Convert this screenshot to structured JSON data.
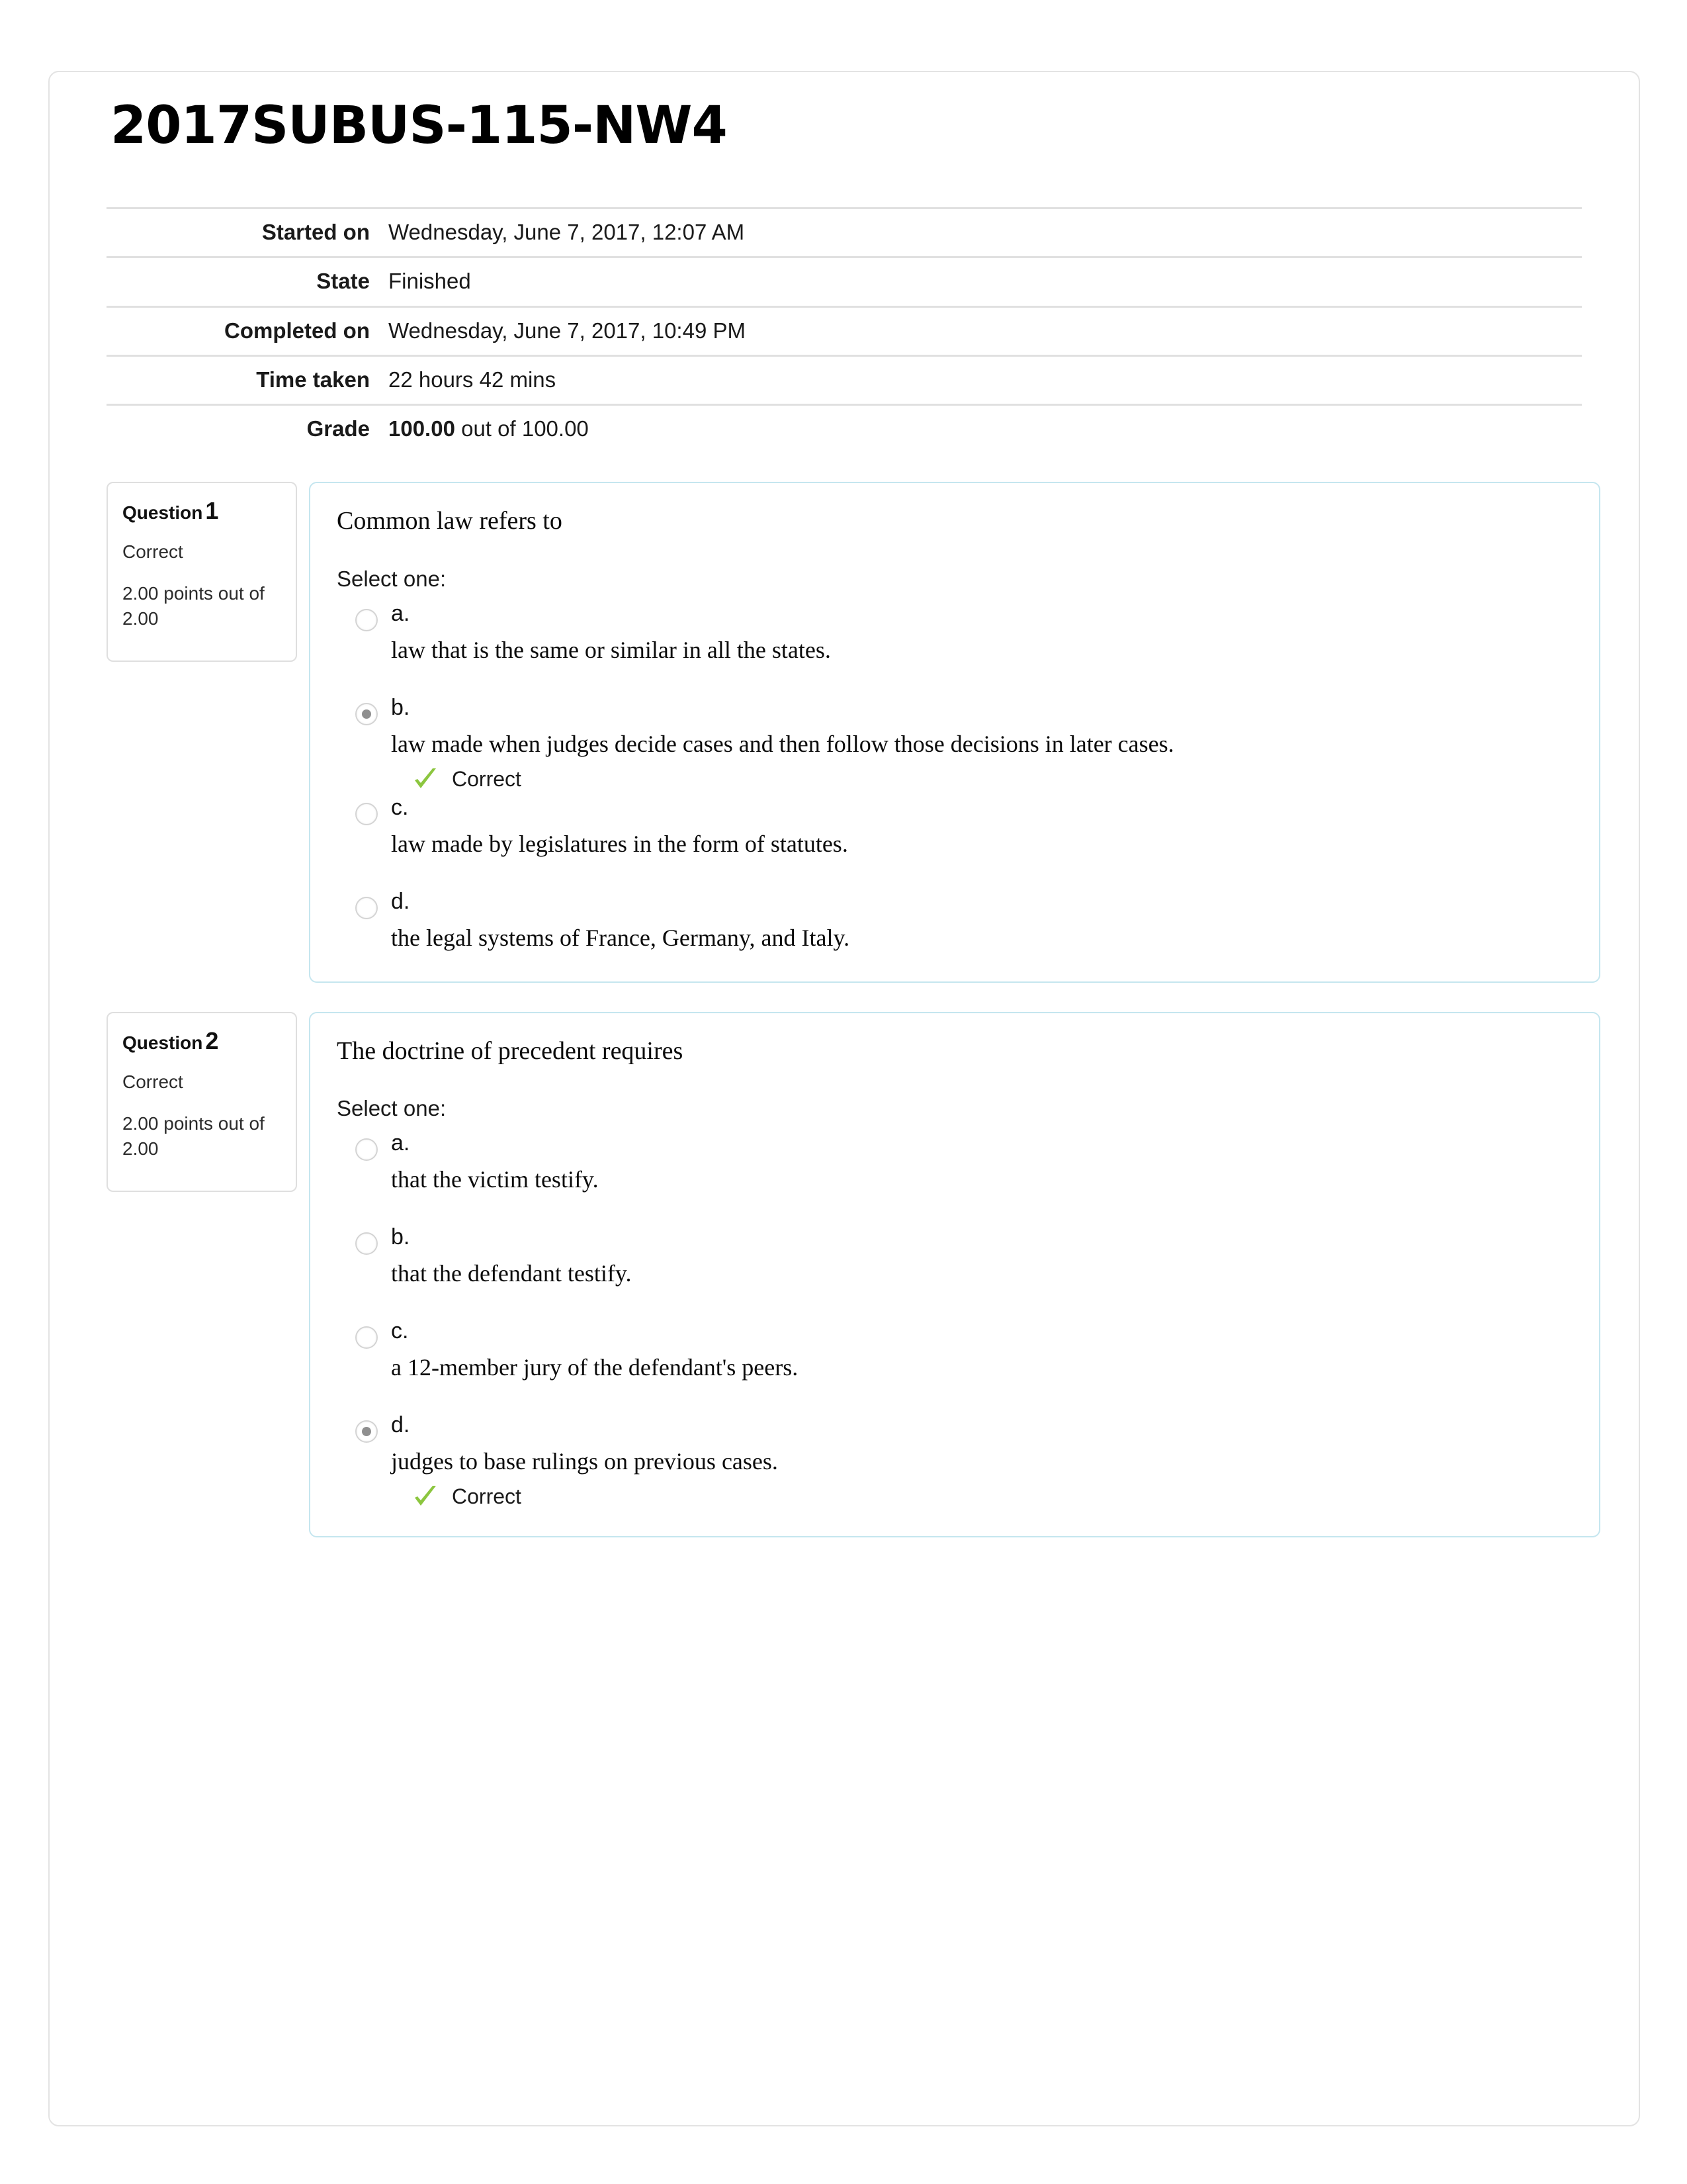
{
  "quiz": {
    "title": "2017SUBUS-115-NW4"
  },
  "summary": {
    "rows": [
      {
        "label": "Started on",
        "value": "Wednesday, June 7, 2017, 12:07 AM"
      },
      {
        "label": "State",
        "value": "Finished"
      },
      {
        "label": "Completed on",
        "value": "Wednesday, June 7, 2017, 10:49 PM"
      },
      {
        "label": "Time taken",
        "value": "22 hours 42 mins"
      }
    ],
    "grade": {
      "label": "Grade",
      "score": "100.00",
      "suffix": " out of 100.00"
    }
  },
  "colors": {
    "card_border": "#c5e6ef",
    "info_border": "#dfdfdf",
    "container_border": "#e3e3e3",
    "correct_green": "#8cc63f",
    "rule": "#e0e0e0"
  },
  "icons": {
    "correct": "check-icon"
  },
  "questions": [
    {
      "info": {
        "heading": "Question",
        "number": "1",
        "state": "Correct",
        "grade": "2.00 points out of 2.00"
      },
      "text": "Common law refers to",
      "select_prompt": "Select one:",
      "options": [
        {
          "letter": "a.",
          "text": "law that is the same or similar in all the states.",
          "selected": false,
          "feedback": ""
        },
        {
          "letter": "b.",
          "text": "law made when judges decide cases and then follow those decisions in later cases.",
          "selected": true,
          "feedback": "Correct"
        },
        {
          "letter": "c.",
          "text": "law made by legislatures in the form of statutes.",
          "selected": false,
          "feedback": ""
        },
        {
          "letter": "d.",
          "text": "the legal systems of France, Germany, and Italy.",
          "selected": false,
          "feedback": ""
        }
      ]
    },
    {
      "info": {
        "heading": "Question",
        "number": "2",
        "state": "Correct",
        "grade": "2.00 points out of 2.00"
      },
      "text": "The doctrine of precedent requires",
      "select_prompt": "Select one:",
      "options": [
        {
          "letter": "a.",
          "text": "that the victim testify.",
          "selected": false,
          "feedback": ""
        },
        {
          "letter": "b.",
          "text": "that the defendant testify.",
          "selected": false,
          "feedback": ""
        },
        {
          "letter": "c.",
          "text": "a 12-member jury of the defendant's peers.",
          "selected": false,
          "feedback": ""
        },
        {
          "letter": "d.",
          "text": "judges to base rulings on previous cases.",
          "selected": true,
          "feedback": "Correct"
        }
      ]
    }
  ]
}
